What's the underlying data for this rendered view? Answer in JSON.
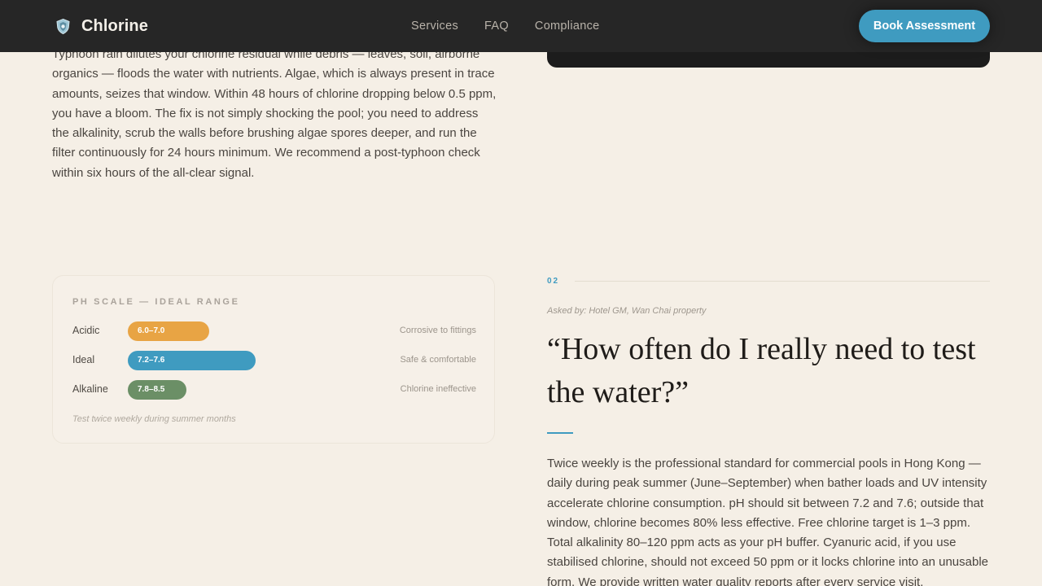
{
  "header": {
    "brand": "Chlorine",
    "brand_icon": "shield-logo-icon",
    "nav": [
      "Services",
      "FAQ",
      "Compliance"
    ],
    "cta": "Book Assessment",
    "accent_color": "#3f9bc0"
  },
  "top": {
    "paragraph": "Typhoon rain dilutes your chlorine residual while debris — leaves, soil, airborne organics — floods the water with nutrients. Algae, which is always present in trace amounts, seizes that window. Within 48 hours of chlorine dropping below 0.5 ppm, you have a bloom. The fix is not simply shocking the pool; you need to address the alkalinity, scrub the walls before brushing algae spores deeper, and run the filter continuously for 24 hours minimum. We recommend a post-typhoon check within six hours of the all-clear signal."
  },
  "ph_card": {
    "title": "PH SCALE — IDEAL RANGE",
    "rows": [
      {
        "label": "Acidic",
        "range": "6.0–7.0",
        "note": "Corrosive to fittings",
        "color": "#e8a444"
      },
      {
        "label": "Ideal",
        "range": "7.2–7.6",
        "note": "Safe & comfortable",
        "color": "#3f9bc0"
      },
      {
        "label": "Alkaline",
        "range": "7.8–8.5",
        "note": "Chlorine ineffective",
        "color": "#6b8f66"
      }
    ],
    "footnote": "Test twice weekly during summer months"
  },
  "faq": {
    "number": "02",
    "asked_by": "Asked by: Hotel GM, Wan Chai property",
    "question": "“How often do I really need to test the water?”",
    "answer": "Twice weekly is the professional standard for commercial pools in Hong Kong — daily during peak summer (June–September) when bather loads and UV intensity accelerate chlorine consumption. pH should sit between 7.2 and 7.6; outside that window, chlorine becomes 80% less effective. Free chlorine target is 1–3 ppm. Total alkalinity 80–120 ppm acts as your pH buffer. Cyanuric acid, if you use stabilised chlorine, should not exceed 50 ppm or it locks chlorine into an unusable form. We provide written water quality reports after every service visit."
  }
}
